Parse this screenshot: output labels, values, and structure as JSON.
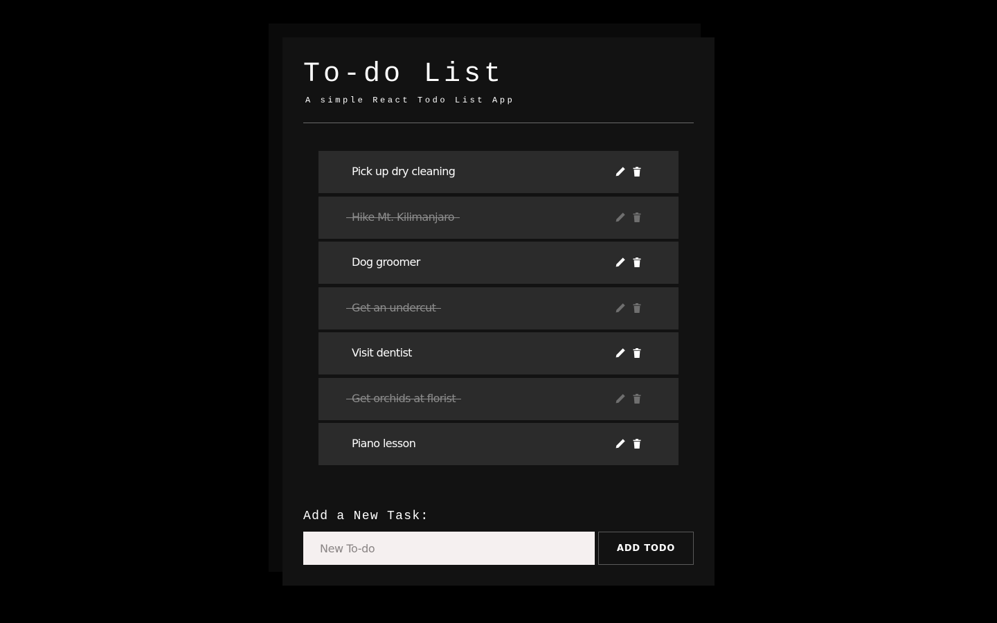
{
  "app": {
    "title": "To-do List",
    "subtitle": "A simple React Todo List App"
  },
  "todos": [
    {
      "text": "Pick up dry cleaning",
      "completed": false
    },
    {
      "text": "Hike Mt. Kilimanjaro",
      "completed": true
    },
    {
      "text": "Dog groomer",
      "completed": false
    },
    {
      "text": "Get an undercut",
      "completed": true
    },
    {
      "text": "Visit dentist",
      "completed": false
    },
    {
      "text": "Get orchids at florist",
      "completed": true
    },
    {
      "text": "Piano lesson",
      "completed": false
    }
  ],
  "icons": {
    "edit": "pencil-icon",
    "delete": "trash-icon"
  },
  "form": {
    "label": "Add a New Task:",
    "placeholder": "New To-do",
    "value": "",
    "button_label": "ADD TODO"
  },
  "colors": {
    "page_background": "#000000",
    "card_background": "#121212",
    "item_background": "#2b2b2b",
    "completed_text": "#8d8d8d",
    "input_background": "#f5f0f0"
  }
}
